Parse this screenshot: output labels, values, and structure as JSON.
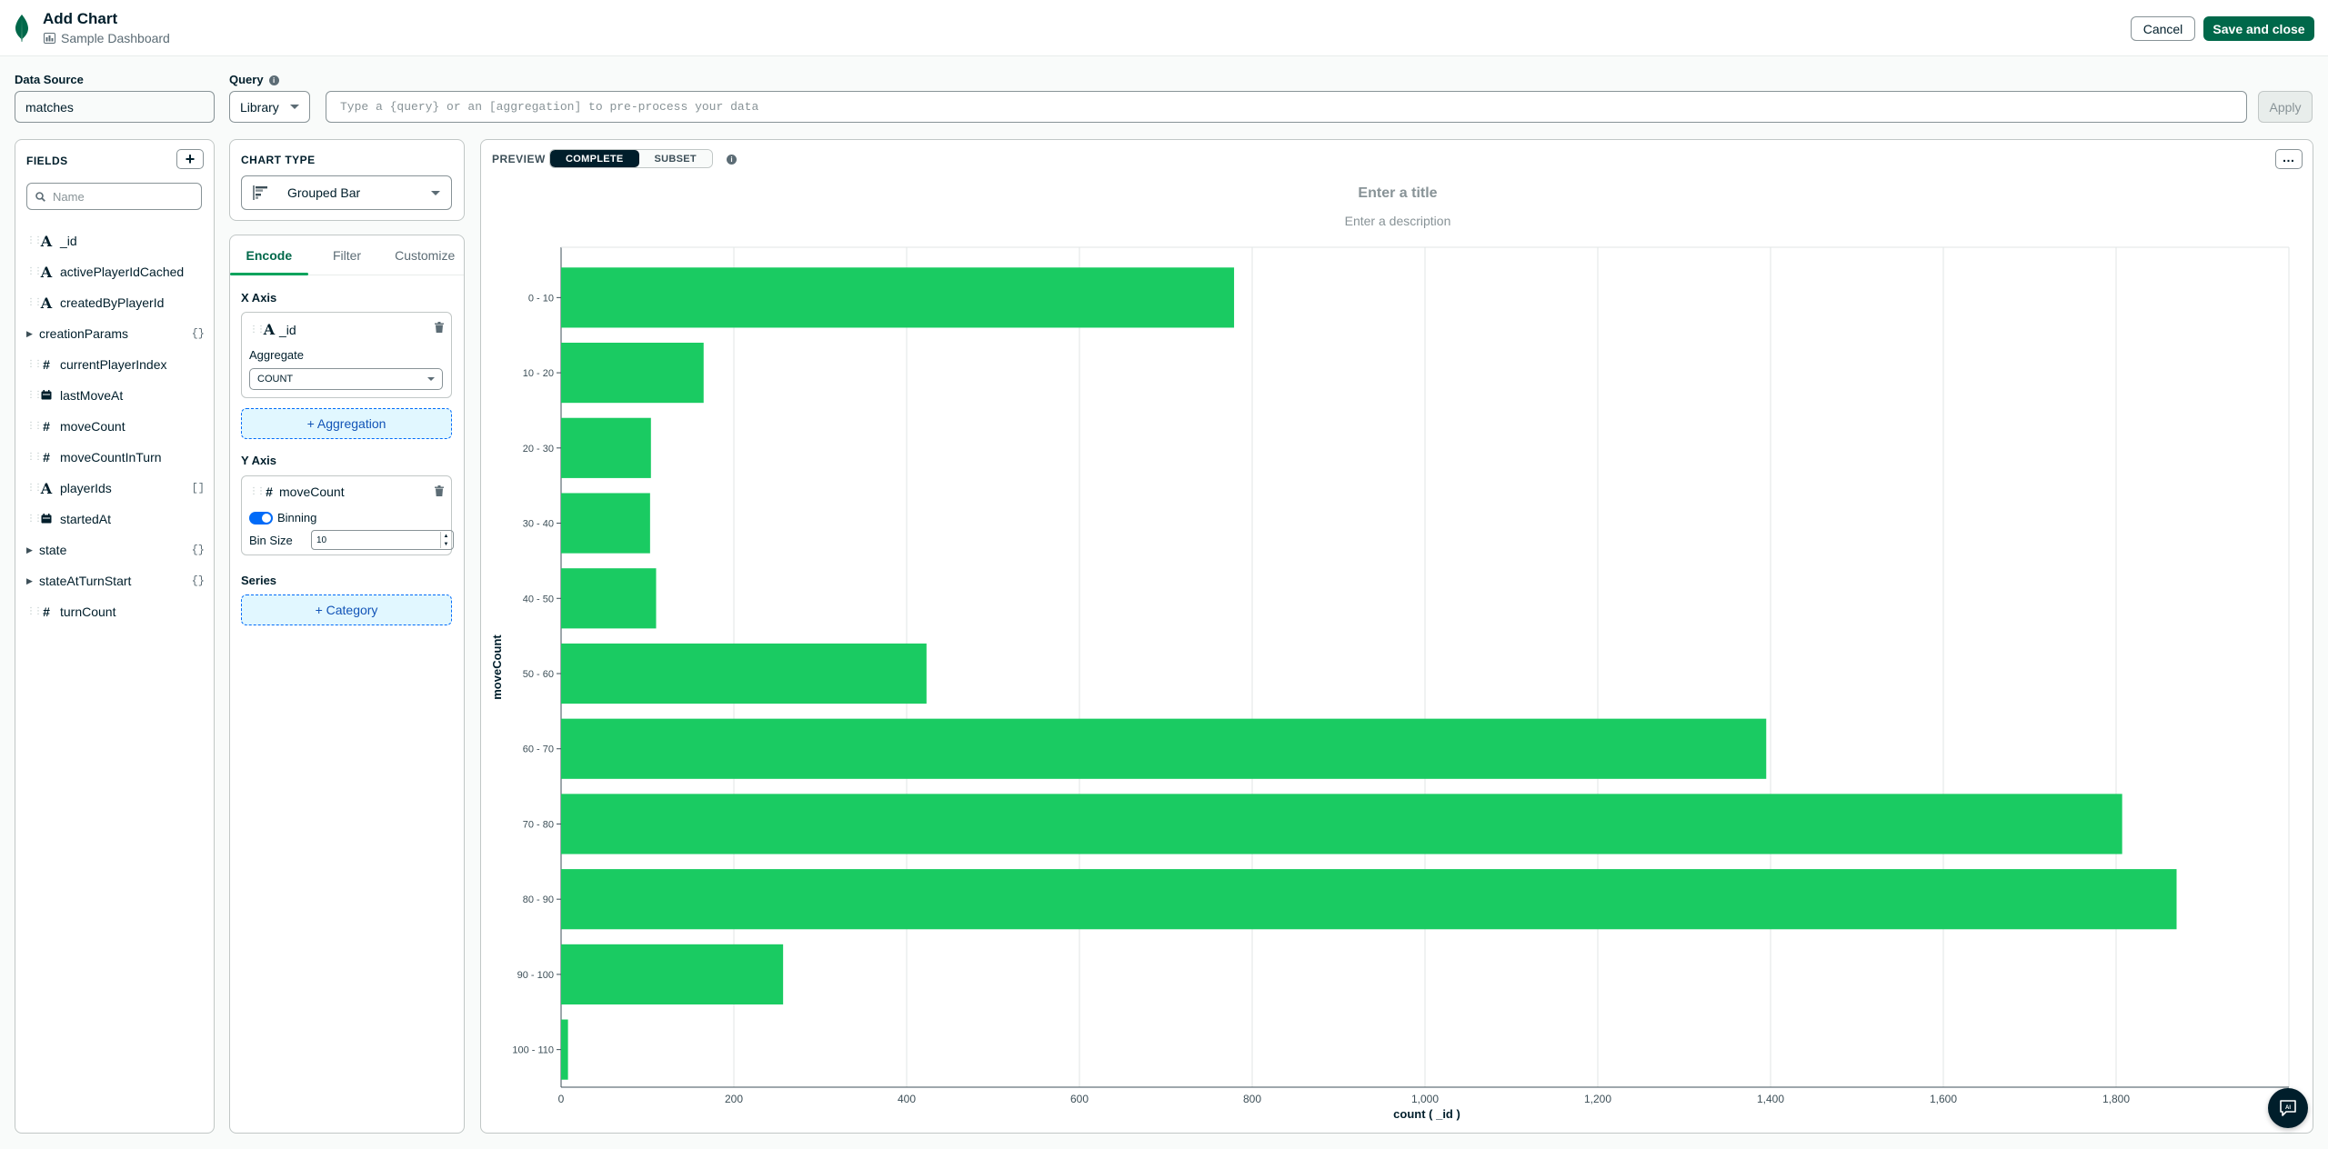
{
  "header": {
    "title": "Add Chart",
    "dashboard_name": "Sample Dashboard",
    "cancel_label": "Cancel",
    "save_label": "Save and close"
  },
  "data_source": {
    "label": "Data Source",
    "value": "matches"
  },
  "query": {
    "label": "Query",
    "mode": "Library",
    "placeholder": "Type a {query} or an [aggregation] to pre-process your data",
    "apply_label": "Apply"
  },
  "fields": {
    "title": "FIELDS",
    "search_placeholder": "Name",
    "items": [
      {
        "name": "_id",
        "type": "A",
        "expandable": false,
        "badge": ""
      },
      {
        "name": "activePlayerIdCached",
        "type": "A",
        "expandable": false,
        "badge": ""
      },
      {
        "name": "createdByPlayerId",
        "type": "A",
        "expandable": false,
        "badge": ""
      },
      {
        "name": "creationParams",
        "type": "",
        "expandable": true,
        "badge": "{}"
      },
      {
        "name": "currentPlayerIndex",
        "type": "#",
        "expandable": false,
        "badge": ""
      },
      {
        "name": "lastMoveAt",
        "type": "date",
        "expandable": false,
        "badge": ""
      },
      {
        "name": "moveCount",
        "type": "#",
        "expandable": false,
        "badge": ""
      },
      {
        "name": "moveCountInTurn",
        "type": "#",
        "expandable": false,
        "badge": ""
      },
      {
        "name": "playerIds",
        "type": "A",
        "expandable": false,
        "badge": "[]"
      },
      {
        "name": "startedAt",
        "type": "date",
        "expandable": false,
        "badge": ""
      },
      {
        "name": "state",
        "type": "",
        "expandable": true,
        "badge": "{}"
      },
      {
        "name": "stateAtTurnStart",
        "type": "",
        "expandable": true,
        "badge": "{}"
      },
      {
        "name": "turnCount",
        "type": "#",
        "expandable": false,
        "badge": ""
      }
    ]
  },
  "chart_type": {
    "title": "CHART TYPE",
    "selected": "Grouped Bar"
  },
  "encode": {
    "tabs": [
      "Encode",
      "Filter",
      "Customize"
    ],
    "active_tab": "Encode",
    "x_axis": {
      "label": "X Axis",
      "field": "_id",
      "field_type": "A",
      "aggregate_label": "Aggregate",
      "aggregate": "COUNT",
      "add_aggregation_label": "+ Aggregation"
    },
    "y_axis": {
      "label": "Y Axis",
      "field": "moveCount",
      "field_type": "#",
      "binning_label": "Binning",
      "binning_on": true,
      "bin_size_label": "Bin Size",
      "bin_size": "10"
    },
    "series": {
      "label": "Series",
      "add_category_label": "+ Category"
    }
  },
  "preview": {
    "label": "PREVIEW",
    "modes": [
      "COMPLETE",
      "SUBSET"
    ],
    "active_mode": "COMPLETE",
    "title_placeholder": "Enter a title",
    "description_placeholder": "Enter a description"
  },
  "colors": {
    "bar": "#1acb62",
    "brand_green": "#00684a",
    "accent_blue": "#016bf8",
    "dark": "#001e2b"
  },
  "chart_data": {
    "type": "bar",
    "orientation": "horizontal",
    "categories": [
      "0 - 10",
      "10 - 20",
      "20 - 30",
      "30 - 40",
      "40 - 50",
      "50 - 60",
      "60 - 70",
      "70 - 80",
      "80 - 90",
      "90 - 100",
      "100 - 110"
    ],
    "values": [
      779,
      165,
      104,
      103,
      110,
      423,
      1395,
      1807,
      1870,
      257,
      8
    ],
    "xlabel": "count ( _id )",
    "ylabel": "moveCount",
    "xlim": [
      0,
      2000
    ],
    "xticks": [
      "0",
      "200",
      "400",
      "600",
      "800",
      "1,000",
      "1,200",
      "1,400",
      "1,600",
      "1,800"
    ],
    "grid": true,
    "legend": "none"
  }
}
